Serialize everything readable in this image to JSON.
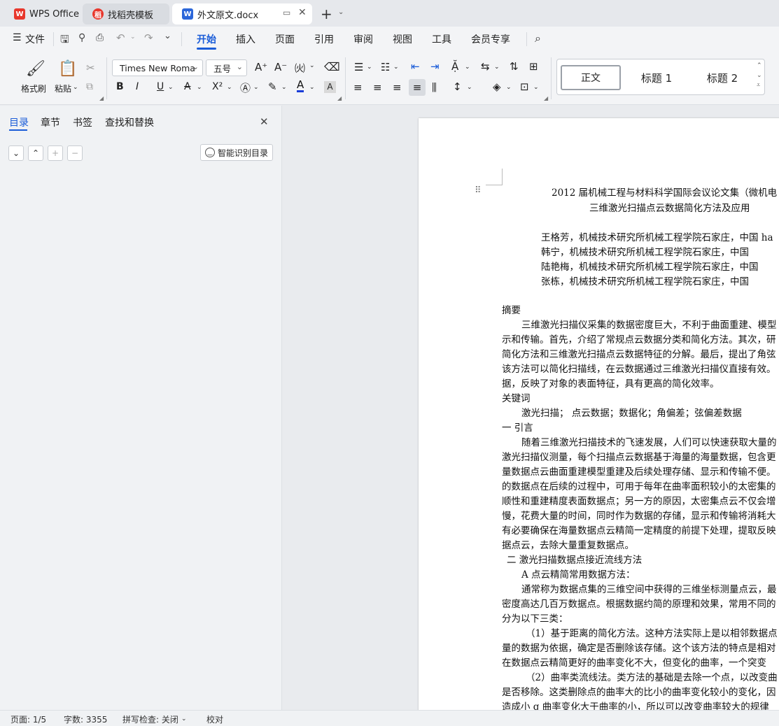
{
  "tabs": [
    {
      "label": "WPS Office",
      "icon": "wps-logo-icon"
    },
    {
      "label": "找稻壳模板",
      "icon": "docer-logo-icon"
    },
    {
      "label": "外文原文.docx",
      "icon": "word-doc-icon"
    }
  ],
  "menu": {
    "file": "文件",
    "items": [
      "开始",
      "插入",
      "页面",
      "引用",
      "审阅",
      "视图",
      "工具",
      "会员专享"
    ]
  },
  "ribbon": {
    "format_painter": "格式刷",
    "paste": "粘贴",
    "font_name": "Times New Roma",
    "font_size": "五号",
    "styles": [
      "正文",
      "标题 1",
      "标题 2"
    ]
  },
  "nav_panel": {
    "tabs": [
      "目录",
      "章节",
      "书签",
      "查找和替换"
    ],
    "smart_toc": "智能识别目录"
  },
  "document": {
    "lines": [
      "2012 届机械工程与材料科学国际会议论文集（微机电",
      "三维激光扫描点云数据简化方法及应用",
      "王格芳，机械技术研究所机械工程学院石家庄，中国 ha",
      "韩宁，机械技术研究所机械工程学院石家庄，中国",
      "陆艳梅，机械技术研究所机械工程学院石家庄，中国",
      "张栋，机械技术研究所机械工程学院石家庄，中国",
      "摘要",
      "三维激光扫描仪采集的数据密度巨大，不利于曲面重建、模型",
      "示和传输。首先，介绍了常规点云数据分类和简化方法。其次，研",
      "简化方法和三维激光扫描点云数据特征的分解。最后，提出了角弦",
      "该方法可以简化扫描线，在云数据通过三维激光扫描仪直接有效。",
      "据，反映了对象的表面特征，具有更高的简化效率。",
      "关键词",
      "激光扫描； 点云数据；数据化；角偏差；弦偏差数据",
      "一  引言",
      "随着三维激光扫描技术的飞速发展，人们可以快速获取大量的",
      "激光扫描仪测量，每个扫描点云数据基于海量的海量数据，包含更",
      "量数据点云曲面重建模型重建及后续处理存储、显示和传输不便。",
      "的数据点在后续的过程中，可用于每年在曲率面积较小的太密集的",
      "顺性和重建精度表面数据点；另一方的原因，太密集点云不仅会增",
      "慢，花费大量的时间，同时作为数据的存储，显示和传输将消耗大",
      "有必要确保在海量数据点云精简一定精度的前提下处理，提取反映",
      "据点云，去除大量重复数据点。",
      "二  激光扫描数据点接近流线方法",
      "A 点云精简常用数据方法：",
      "通常称为数据点集的三维空间中获得的三维坐标测量点云，最",
      "密度高达几百万数据点。根据数据约简的原理和效果，常用不同的",
      "分为以下三类：",
      "（1）基于距离的简化方法。这种方法实际上是以相邻数据点",
      "量的数据为依据，确定是否删除该存储。这个该方法的特点是相对",
      "在数据点云精简更好的曲率变化不大，但变化的曲率，一个突变",
      "（2）曲率类流线法。类方法的基础是去除一个点，以改变曲",
      "是否移除。这类删除点的曲率大的比小的曲率变化较小的变化，因",
      "造成小 g 曲率变化大于曲率的小，所以可以改变曲率较大的规律"
    ]
  },
  "status": {
    "page": "页面: 1/5",
    "words": "字数: 3355",
    "spell": "拼写检查: 关闭",
    "proof": "校对"
  }
}
